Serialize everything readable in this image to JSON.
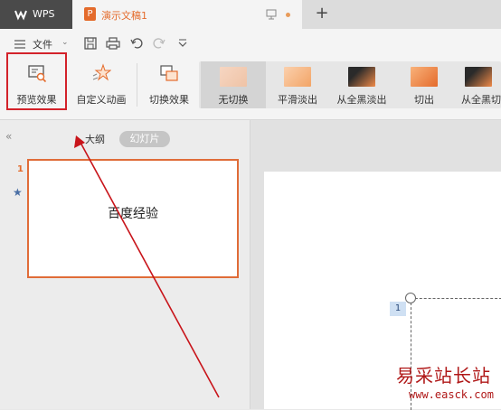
{
  "titlebar": {
    "app_tab": "WPS",
    "doc_title": "演示文稿1",
    "new_tab": "+"
  },
  "menubar": {
    "file": "文件"
  },
  "ribbon": {
    "preview": "预览效果",
    "custom_animation": "自定义动画",
    "switch_effect": "切换效果",
    "transitions": [
      "无切换",
      "平滑淡出",
      "从全黑淡出",
      "切出",
      "从全黑切"
    ]
  },
  "left_panel": {
    "outline_tab": "大纲",
    "slides_tab": "幻灯片",
    "slide_number": "1",
    "slide_text": "百度经验"
  },
  "canvas": {
    "placeholder_number": "1"
  },
  "watermark": {
    "title": "易采站长站",
    "url": "www.easck.com"
  },
  "colors": {
    "accent": "#e46b2c",
    "highlight_box": "#d3222a",
    "arrow": "#c8141a"
  }
}
